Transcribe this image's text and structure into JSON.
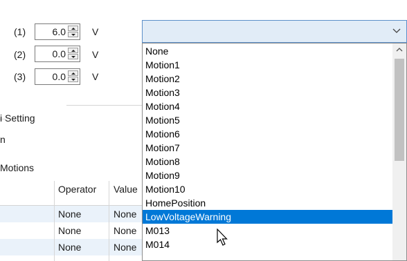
{
  "voltages": [
    {
      "label": "(1)",
      "value": "6.0",
      "unit": "V"
    },
    {
      "label": "(2)",
      "value": "0.0",
      "unit": "V"
    },
    {
      "label": "(3)",
      "value": "0.0",
      "unit": "V"
    }
  ],
  "section_setting_label": "i Setting",
  "n_label": "n",
  "motions_label": "Motions",
  "table": {
    "headers": [
      "Operator",
      "Value"
    ],
    "rows": [
      [
        "None",
        "None"
      ],
      [
        "None",
        "None"
      ],
      [
        "None",
        "None"
      ]
    ]
  },
  "combo": {
    "value": "",
    "chevron": "chevron-down-icon"
  },
  "dropdown": {
    "options": [
      "None",
      "Motion1",
      "Motion2",
      "Motion3",
      "Motion4",
      "Motion5",
      "Motion6",
      "Motion7",
      "Motion8",
      "Motion9",
      "Motion10",
      "HomePosition",
      "LowVoltageWarning",
      "M013",
      "M014"
    ],
    "selected": "LowVoltageWarning"
  },
  "colors": {
    "selection": "#0078d7",
    "combo_bg": "#e1ecf7",
    "row_alt": "#eaf2fa"
  }
}
